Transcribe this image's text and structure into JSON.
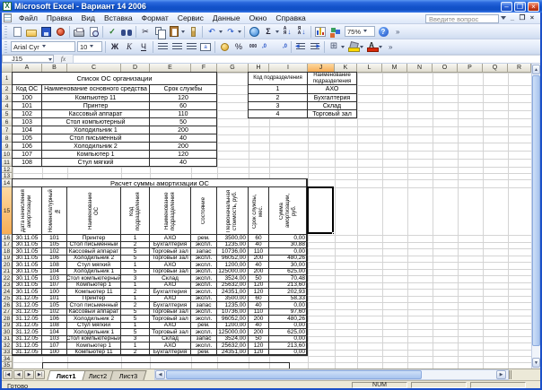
{
  "window": {
    "title": "Microsoft Excel - Вариант 14 2006",
    "controls": {
      "minimize": "–",
      "maximize": "❐",
      "close": "×"
    }
  },
  "menu": {
    "items": [
      "Файл",
      "Правка",
      "Вид",
      "Вставка",
      "Формат",
      "Сервис",
      "Данные",
      "Окно",
      "Справка"
    ],
    "question_box": "Введите вопрос",
    "workbook_controls": {
      "minimize": "_",
      "restore": "❐",
      "close": "×"
    }
  },
  "toolbars": {
    "standard_icons": [
      "new",
      "open",
      "save",
      "permission",
      "print",
      "print-preview",
      "spelling",
      "research",
      "cut",
      "copy",
      "paste",
      "format-painter",
      "undo",
      "redo",
      "hyperlink",
      "autosum",
      "sort-ascending",
      "sort-descending",
      "chart-wizard",
      "drawing"
    ],
    "zoom_value": "75%",
    "help_label": "?",
    "font_name": "Arial Cyr",
    "font_size": "10",
    "bold_label": "Ж",
    "italic_label": "К",
    "underline_label": "Ч",
    "percent_label": "%",
    "thousands_label": "000"
  },
  "formula_bar": {
    "name_box": "J15",
    "fx_label": "fx",
    "content": ""
  },
  "sheet": {
    "column_letters": [
      "A",
      "B",
      "C",
      "D",
      "E",
      "F",
      "G",
      "H",
      "I",
      "J",
      "K",
      "L",
      "M",
      "N",
      "O",
      "P",
      "Q",
      "R"
    ],
    "row_numbers": [
      "1",
      "2",
      "3",
      "4",
      "5",
      "6",
      "7",
      "8",
      "9",
      "10",
      "11",
      "12",
      "13",
      "14",
      "15",
      "16",
      "17",
      "18",
      "19",
      "20",
      "21",
      "22",
      "23",
      "24",
      "25",
      "26",
      "27",
      "28",
      "29",
      "30",
      "31",
      "32",
      "33",
      "34",
      "35"
    ],
    "selected_cell": "J15",
    "selected_column": "J",
    "selected_row": "15"
  },
  "tables": {
    "os_list": {
      "title": "Список ОС организации",
      "headers": [
        "Код ОС",
        "Наименование основного средства",
        "Срок службы"
      ],
      "rows": [
        [
          "100",
          "Компьютер 11",
          "120"
        ],
        [
          "101",
          "Принтер",
          "60"
        ],
        [
          "102",
          "Кассовый аппарат",
          "110"
        ],
        [
          "103",
          "Стол компьютерный",
          "50"
        ],
        [
          "104",
          "Холодильник 1",
          "200"
        ],
        [
          "105",
          "Стол письменный",
          "40"
        ],
        [
          "106",
          "Холодильник 2",
          "200"
        ],
        [
          "107",
          "Компьютер 1",
          "120"
        ],
        [
          "108",
          "Стул мягкий",
          "40"
        ]
      ]
    },
    "departments": {
      "headers": [
        "Код подразделения",
        "Наименование подразделения"
      ],
      "rows": [
        [
          "1",
          "АХО"
        ],
        [
          "2",
          "Бухгалтерия"
        ],
        [
          "3",
          "Склад"
        ],
        [
          "4",
          "Торговый зал"
        ]
      ]
    },
    "amortization": {
      "title": "Расчет суммы амортизации ОС",
      "headers": [
        "Дата начисления амортизации",
        "Номенклатурный №",
        "Наименование ОС",
        "Код подразделения",
        "Наименование подразделения",
        "Состояние",
        "Первоначальная стоимость, руб.",
        "Срок службы, мес.",
        "Сумма амортизации, руб."
      ],
      "rows": [
        [
          "30.11.05",
          "101",
          "Принтер",
          "1",
          "АХО",
          "рем.",
          "3500,00",
          "60",
          "0,00"
        ],
        [
          "30.11.05",
          "105",
          "Стол письменный",
          "2",
          "Бухгалтерия",
          "экспл.",
          "1235,00",
          "40",
          "30,88"
        ],
        [
          "30.11.05",
          "102",
          "Кассовый аппарат",
          "5",
          "Торговый зал",
          "запас",
          "10736,00",
          "110",
          "0,00"
        ],
        [
          "30.11.05",
          "106",
          "Холодильник 2",
          "5",
          "Торговый зал",
          "экспл.",
          "96052,00",
          "200",
          "480,26"
        ],
        [
          "30.11.05",
          "108",
          "Стул мягкий",
          "1",
          "АХО",
          "экспл.",
          "1200,00",
          "40",
          "30,00"
        ],
        [
          "30.11.05",
          "104",
          "Холодильник 1",
          "5",
          "Торговый зал",
          "экспл.",
          "125000,00",
          "200",
          "625,00"
        ],
        [
          "30.11.05",
          "103",
          "Стол компьютерный",
          "3",
          "Склад",
          "экспл.",
          "3524,00",
          "50",
          "70,48"
        ],
        [
          "30.11.05",
          "107",
          "Компьютер 1",
          "1",
          "АХО",
          "экспл.",
          "25632,00",
          "120",
          "213,60"
        ],
        [
          "30.11.05",
          "100",
          "Компьютер 11",
          "2",
          "Бухгалтерия",
          "экспл.",
          "24351,00",
          "120",
          "202,93"
        ],
        [
          "31.12.05",
          "101",
          "Принтер",
          "1",
          "АХО",
          "экспл.",
          "3500,00",
          "60",
          "58,33"
        ],
        [
          "31.12.05",
          "105",
          "Стол письменный",
          "2",
          "Бухгалтерия",
          "запас",
          "1235,00",
          "40",
          "0,00"
        ],
        [
          "31.12.05",
          "102",
          "Кассовый аппарат",
          "5",
          "Торговый зал",
          "экспл.",
          "10736,00",
          "110",
          "97,60"
        ],
        [
          "31.12.05",
          "106",
          "Холодильник 2",
          "5",
          "Торговый зал",
          "экспл.",
          "96052,00",
          "200",
          "480,26"
        ],
        [
          "31.12.05",
          "108",
          "Стул мягкий",
          "1",
          "АХО",
          "рем.",
          "1200,00",
          "40",
          "0,00"
        ],
        [
          "31.12.05",
          "104",
          "Холодильник 1",
          "5",
          "Торговый зал",
          "экспл.",
          "125000,00",
          "200",
          "625,00"
        ],
        [
          "31.12.05",
          "103",
          "Стол компьютерный",
          "3",
          "Склад",
          "запас",
          "3524,00",
          "50",
          "0,00"
        ],
        [
          "31.12.05",
          "107",
          "Компьютер 1",
          "1",
          "АХО",
          "экспл.",
          "25632,00",
          "120",
          "213,60"
        ],
        [
          "31.12.05",
          "100",
          "Компьютер 11",
          "2",
          "Бухгалтерия",
          "рем.",
          "24351,00",
          "120",
          "0,00"
        ]
      ]
    }
  },
  "tabs": {
    "sheets": [
      "Лист1",
      "Лист2",
      "Лист3"
    ],
    "active": "Лист1"
  },
  "status_bar": {
    "ready": "Готово",
    "num": "NUM"
  },
  "colors": {
    "title_bar": "#1252ca",
    "selected_header": "#f9bd70",
    "grid_line": "#d4d4d4",
    "toolbar_bg": "#e2eaf8"
  }
}
